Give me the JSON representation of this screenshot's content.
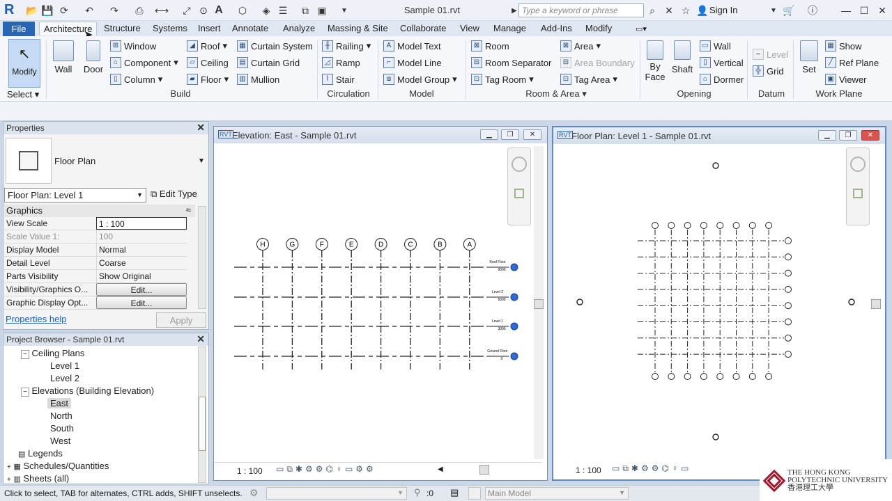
{
  "title_bar": {
    "app_logo": "R",
    "document_title": "Sample 01.rvt",
    "search_placeholder": "Type a keyword or phrase",
    "sign_in": "Sign In"
  },
  "tabs": [
    "File",
    "Architecture",
    "Structure",
    "Systems",
    "Insert",
    "Annotate",
    "Analyze",
    "Massing & Site",
    "Collaborate",
    "View",
    "Manage",
    "Add-Ins",
    "Modify"
  ],
  "ribbon": {
    "modify": "Modify",
    "select": "Select",
    "build": {
      "wall": "Wall",
      "door": "Door",
      "window": "Window",
      "component": "Component",
      "column": "Column",
      "roof": "Roof",
      "ceiling": "Ceiling",
      "floor": "Floor",
      "curtain_system": "Curtain System",
      "curtain_grid": "Curtain Grid",
      "mullion": "Mullion",
      "label": "Build"
    },
    "circulation": {
      "railing": "Railing",
      "ramp": "Ramp",
      "stair": "Stair",
      "label": "Circulation"
    },
    "model": {
      "model_text": "Model Text",
      "model_line": "Model Line",
      "model_group": "Model Group",
      "label": "Model"
    },
    "room_area": {
      "room": "Room",
      "room_separator": "Room Separator",
      "tag_room": "Tag Room",
      "area": "Area",
      "area_boundary": "Area Boundary",
      "tag_area": "Tag Area",
      "label": "Room & Area"
    },
    "opening": {
      "by_face_1": "By",
      "by_face_2": "Face",
      "shaft": "Shaft",
      "wall": "Wall",
      "vertical": "Vertical",
      "dormer": "Dormer",
      "label": "Opening"
    },
    "datum": {
      "level": "Level",
      "grid": "Grid",
      "label": "Datum"
    },
    "work_plane": {
      "set": "Set",
      "show": "Show",
      "ref_plane": "Ref Plane",
      "viewer": "Viewer",
      "label": "Work Plane"
    }
  },
  "properties": {
    "header": "Properties",
    "type_name": "Floor Plan",
    "instance_selector": "Floor Plan: Level 1",
    "edit_type": "Edit Type",
    "section": "Graphics",
    "rows": [
      {
        "key": "View Scale",
        "value": "1 : 100"
      },
      {
        "key": "Scale Value    1:",
        "value": "100"
      },
      {
        "key": "Display Model",
        "value": "Normal"
      },
      {
        "key": "Detail Level",
        "value": "Coarse"
      },
      {
        "key": "Parts Visibility",
        "value": "Show Original"
      },
      {
        "key": "Visibility/Graphics O...",
        "value": "Edit..."
      },
      {
        "key": "Graphic Display Opt...",
        "value": "Edit..."
      }
    ],
    "help": "Properties help",
    "apply": "Apply"
  },
  "browser": {
    "header": "Project Browser - Sample 01.rvt",
    "items": [
      {
        "label": "Ceiling Plans",
        "level": 1,
        "toggle": "−"
      },
      {
        "label": "Level 1",
        "level": 2
      },
      {
        "label": "Level 2",
        "level": 2
      },
      {
        "label": "Elevations (Building Elevation)",
        "level": 1,
        "toggle": "−"
      },
      {
        "label": "East",
        "level": 2,
        "selected": true
      },
      {
        "label": "North",
        "level": 2
      },
      {
        "label": "South",
        "level": 2
      },
      {
        "label": "West",
        "level": 2
      },
      {
        "label": "Legends",
        "level": 0,
        "toggle": ""
      },
      {
        "label": "Schedules/Quantities",
        "level": 0,
        "toggle": "+"
      },
      {
        "label": "Sheets (all)",
        "level": 0,
        "toggle": "+"
      }
    ]
  },
  "elevation_view": {
    "title": "Elevation: East - Sample 01.rvt",
    "scale": "1 : 100",
    "grids": [
      "H",
      "G",
      "F",
      "E",
      "D",
      "C",
      "B",
      "A"
    ],
    "levels": [
      {
        "name": "Roof Floor",
        "elev": "9000"
      },
      {
        "name": "Level 2",
        "elev": "6000"
      },
      {
        "name": "Level 1",
        "elev": "3000"
      },
      {
        "name": "Ground Floor",
        "elev": "0"
      }
    ]
  },
  "plan_view": {
    "title": "Floor Plan: Level 1 - Sample 01.rvt",
    "scale": "1 : 100"
  },
  "status": {
    "message": "Click to select, TAB for alternates, CTRL adds, SHIFT unselects.",
    "selection_count": ":0",
    "model": "Main Model"
  },
  "watermark": {
    "line1": "THE HONG KONG",
    "line2": "POLYTECHNIC UNIVERSITY",
    "line3": "香港理工大學"
  }
}
